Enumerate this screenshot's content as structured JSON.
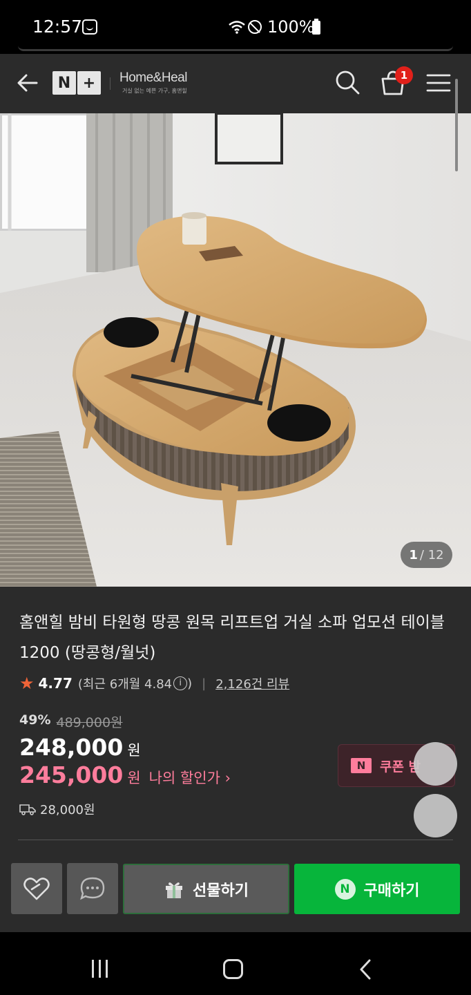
{
  "status_bar": {
    "time": "12:57",
    "battery": "100%",
    "icons": [
      "calendar-icon",
      "wifi-icon",
      "do-not-disturb-icon",
      "battery-icon"
    ]
  },
  "header": {
    "logo": "N+",
    "brand_name": "Home&Heal",
    "brand_tagline": "거실 없는 예쁜 가구, 홈앤힐",
    "cart_count": "1",
    "icons": [
      "back-arrow-icon",
      "search-icon",
      "shopping-bag-icon",
      "hamburger-menu-icon"
    ]
  },
  "gallery": {
    "current": "1",
    "total": "/ 12"
  },
  "product": {
    "title": "홈앤힐 밤비 타원형 땅콩 원목 리프트업 거실 소파 업모션 테이블 1200 (땅콩형/월넛)",
    "rating": "4.77",
    "rating_recent": "(최근 6개월 4.84",
    "rating_close": ")",
    "reviews": "2,126건 리뷰"
  },
  "price": {
    "discount": "49%",
    "original": "489,000원",
    "sale": "248,000",
    "sale_unit": "원",
    "my_price": "245,000",
    "my_unit": "원",
    "my_label": "나의 할인가 ›",
    "coupon_label": "쿠폰 받",
    "shipping": "28,000원"
  },
  "actions": {
    "gift": "선물하기",
    "buy": "구매하기",
    "npay": "N"
  },
  "colors": {
    "background": "#2b2b2b",
    "accent_pink": "#ff7d9c",
    "buy_green": "#07b53b",
    "star": "#f06438",
    "badge_red": "#e1201a"
  }
}
